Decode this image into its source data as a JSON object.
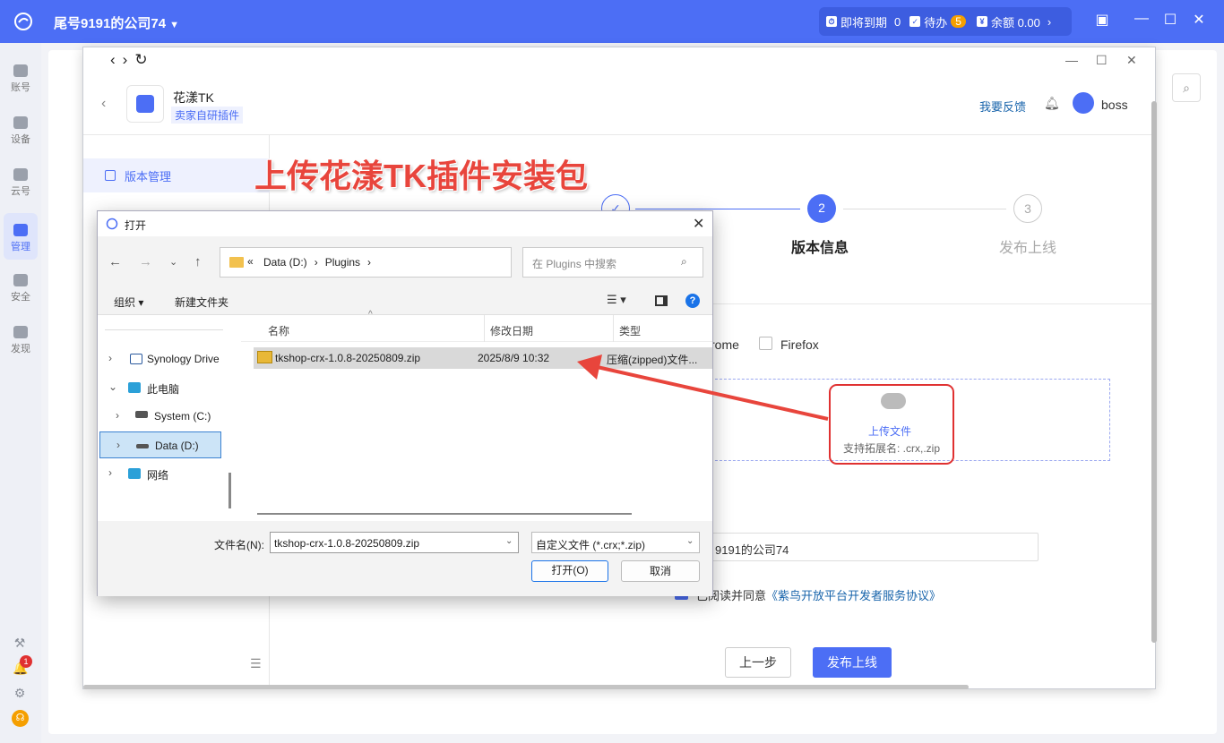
{
  "app": {
    "company": "尾号9191的公司74"
  },
  "status": {
    "expiring_label": "即将到期",
    "expiring_count": "0",
    "todo_label": "待办",
    "todo_count": "5",
    "balance_label": "余额 0.00"
  },
  "left_nav": [
    {
      "label": "账号"
    },
    {
      "label": "设备"
    },
    {
      "label": "云号"
    },
    {
      "label": "管理"
    },
    {
      "label": "安全"
    },
    {
      "label": "发现"
    }
  ],
  "notification_badge": "1",
  "plugin": {
    "title": "花漾TK",
    "tag": "卖家自研插件"
  },
  "header": {
    "feedback": "我要反馈",
    "username": "boss"
  },
  "menu": {
    "version_mgmt": "版本管理"
  },
  "annotation": "上传花漾TK插件安装包",
  "steps": [
    {
      "num": "✓",
      "label": ""
    },
    {
      "num": "2",
      "label": "版本信息"
    },
    {
      "num": "3",
      "label": "发布上线"
    }
  ],
  "browser_options": {
    "chrome": "rome",
    "firefox": "Firefox"
  },
  "upload": {
    "label": "上传文件",
    "hint": "支持拓展名: .crx,.zip"
  },
  "org_value": "9191的公司74",
  "agree": {
    "text": "已阅读并同意",
    "link": "《紫鸟开放平台开发者服务协议》"
  },
  "buttons": {
    "prev": "上一步",
    "publish": "发布上线"
  },
  "dialog": {
    "title": "打开",
    "path_prefix": "«",
    "path": [
      "Data (D:)",
      "Plugins"
    ],
    "search_placeholder": "在 Plugins 中搜索",
    "organize": "组织 ▾",
    "new_folder": "新建文件夹",
    "tree": [
      {
        "label": "Synology Drive",
        "expanded": false
      },
      {
        "label": "此电脑",
        "expanded": true
      },
      {
        "label": "System (C:)",
        "expanded": false
      },
      {
        "label": "Data (D:)",
        "expanded": false
      },
      {
        "label": "网络",
        "expanded": false
      }
    ],
    "columns": [
      "名称",
      "修改日期",
      "类型"
    ],
    "file": {
      "name": "tkshop-crx-1.0.8-20250809.zip",
      "date": "2025/8/9 10:32",
      "type": "压缩(zipped)文件..."
    },
    "filename_label": "文件名(N):",
    "filename_value": "tkshop-crx-1.0.8-20250809.zip",
    "filter": "自定义文件 (*.crx;*.zip)",
    "open_btn": "打开(O)",
    "cancel_btn": "取消"
  },
  "colors": {
    "accent": "#4c6ef5",
    "annotation": "#e8453c"
  }
}
